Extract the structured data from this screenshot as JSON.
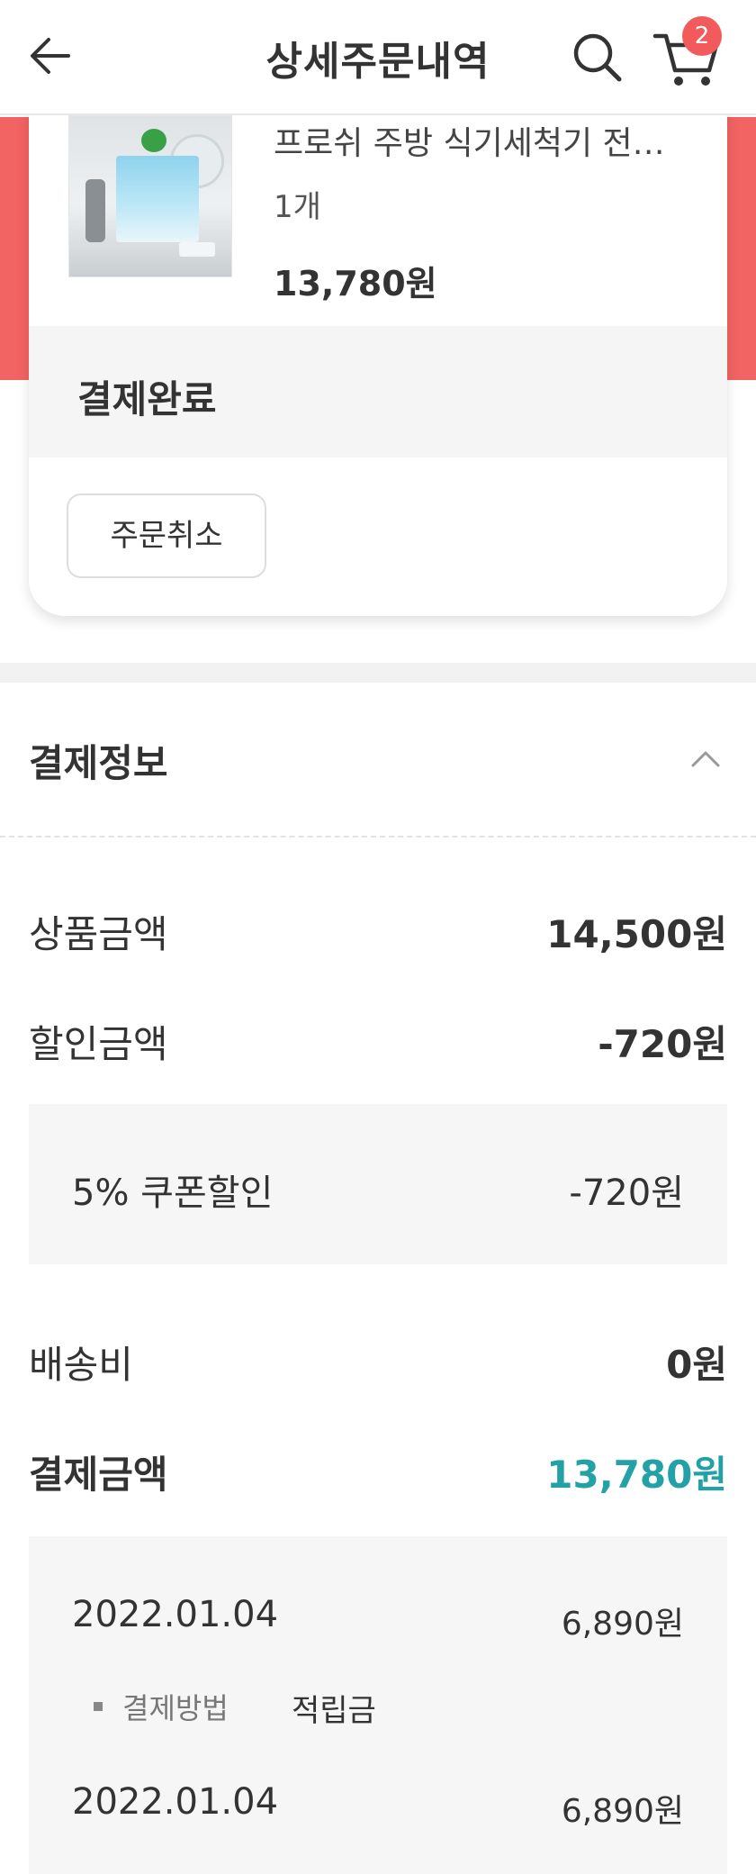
{
  "header": {
    "title": "상세주문내역",
    "back_icon": "arrow-left-icon",
    "search_icon": "search-icon",
    "cart_icon": "cart-icon",
    "cart_count": "2"
  },
  "colors": {
    "brand_red": "#f26363",
    "badge_red": "#f15b5b",
    "accent_teal": "#22a2a6"
  },
  "order": {
    "product_name": "프로쉬 주방 식기세척기 전…",
    "quantity": "1개",
    "price": "13,780원",
    "status": "결제완료",
    "cancel_label": "주문취소"
  },
  "payment": {
    "title": "결제정보",
    "collapse_icon": "chevron-up-icon",
    "rows": [
      {
        "label": "상품금액",
        "value": "14,500원"
      },
      {
        "label": "할인금액",
        "value": "-720원"
      }
    ],
    "discount_detail": {
      "label": "5% 쿠폰할인",
      "value": "-720원"
    },
    "shipping": {
      "label": "배송비",
      "value": "0원"
    },
    "total": {
      "label": "결제금액",
      "value": "13,780원"
    },
    "history": [
      {
        "date": "2022.01.04",
        "amount": "6,890원",
        "method_label": "결제방법",
        "method_value": "적립금"
      },
      {
        "date": "2022.01.04",
        "amount": "6,890원"
      }
    ]
  }
}
